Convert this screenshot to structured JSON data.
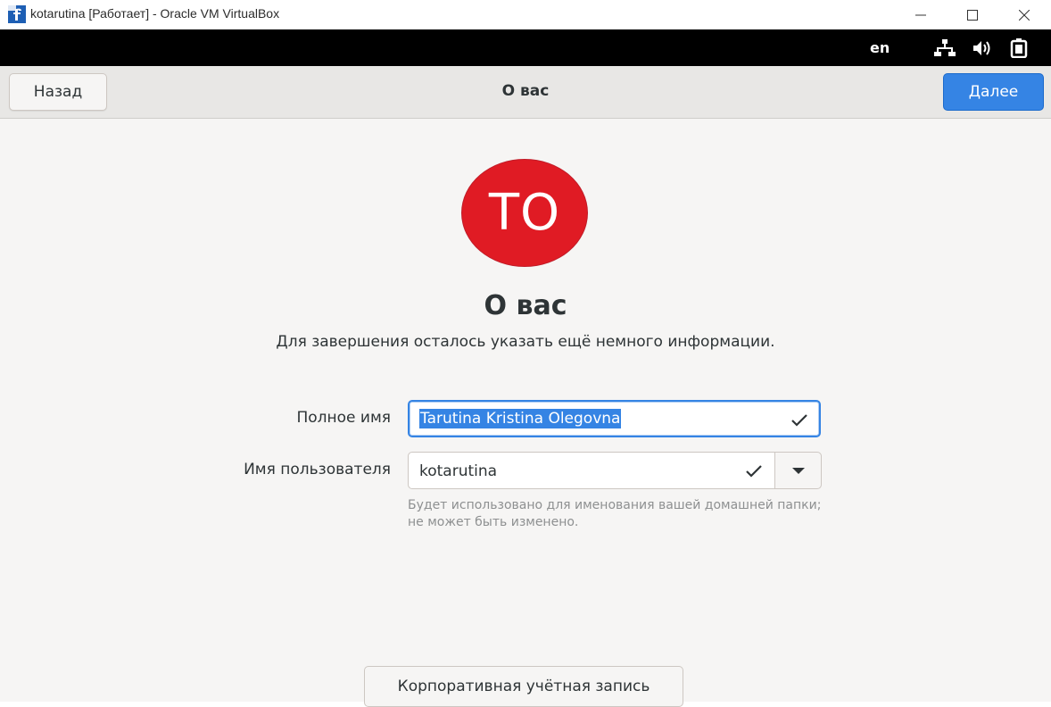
{
  "window": {
    "title": "kotarutina [Работает] - Oracle VM VirtualBox"
  },
  "topbar": {
    "language": "en",
    "icons": [
      "network-icon",
      "volume-icon",
      "battery-icon"
    ]
  },
  "headerbar": {
    "back_label": "Назад",
    "title": "О вас",
    "next_label": "Далее"
  },
  "main": {
    "avatar_initials": "ТО",
    "heading": "О вас",
    "subtitle": "Для завершения осталось указать ещё немного информации.",
    "fullname_label": "Полное имя",
    "fullname_value": "Tarutina Kristina Olegovna",
    "username_label": "Имя пользователя",
    "username_value": "kotarutina",
    "hint": "Будет использовано для именования вашей домашней папки; не может быть изменено.",
    "enterprise_button": "Корпоративная учётная запись"
  },
  "colors": {
    "accent": "#3584e4",
    "avatar": "#e01b24",
    "background": "#f6f5f4"
  }
}
